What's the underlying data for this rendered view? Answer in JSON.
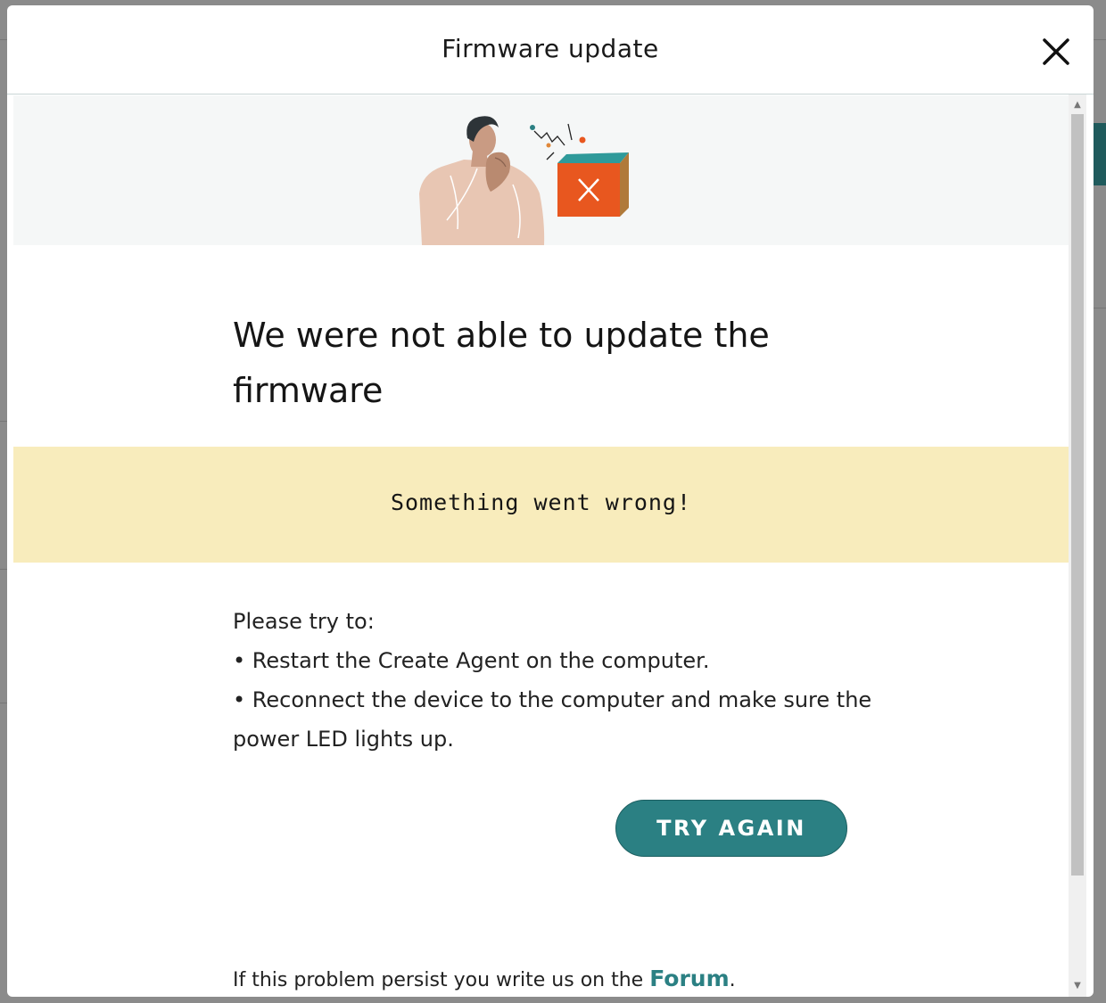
{
  "modal": {
    "title": "Firmware update",
    "close_icon": "close-icon",
    "headline": "We were not able to update the firmware",
    "alert_text": "Something went wrong!",
    "instructions": [
      "Please try to:",
      "• Restart the Create Agent on the computer.",
      "• Reconnect the device to the computer and make sure the power LED lights up."
    ],
    "try_again_label": "TRY AGAIN",
    "footer_prefix": "If this problem persist you write us on the ",
    "forum_label": "Forum",
    "footer_suffix": "."
  },
  "colors": {
    "accent": "#2b8083",
    "alert_bg": "#f8ecbc",
    "hero_bg": "#f5f7f7",
    "error_box": "#e8571f"
  },
  "illustration": "confused-person-with-broken-box-illustration"
}
